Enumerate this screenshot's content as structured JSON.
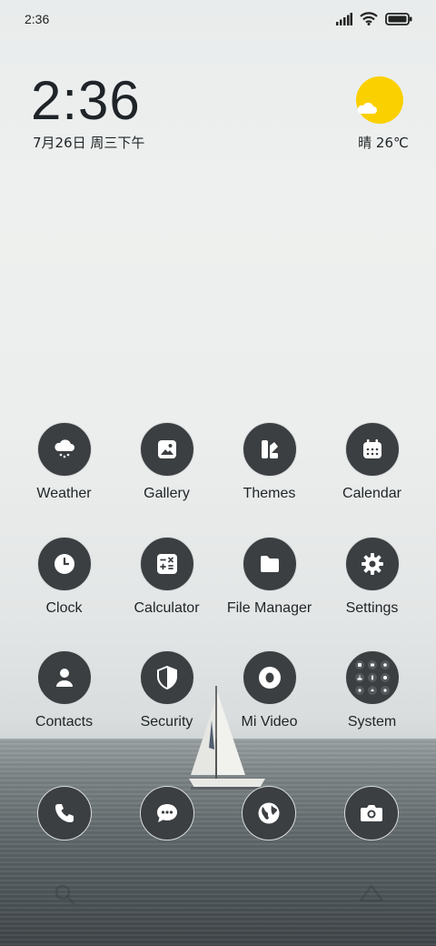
{
  "status": {
    "time": "2:36"
  },
  "clock": {
    "time": "2:36",
    "date": "7月26日 周三下午"
  },
  "weather": {
    "summary": "晴 26℃",
    "sun_color": "#fbd000"
  },
  "apps": [
    {
      "label": "Weather",
      "icon": "cloud-snow-icon"
    },
    {
      "label": "Gallery",
      "icon": "image-icon"
    },
    {
      "label": "Themes",
      "icon": "themes-icon"
    },
    {
      "label": "Calendar",
      "icon": "calendar-icon"
    },
    {
      "label": "Clock",
      "icon": "clock-icon"
    },
    {
      "label": "Calculator",
      "icon": "calculator-icon"
    },
    {
      "label": "File Manager",
      "icon": "folder-icon"
    },
    {
      "label": "Settings",
      "icon": "gear-icon"
    },
    {
      "label": "Contacts",
      "icon": "person-icon"
    },
    {
      "label": "Security",
      "icon": "shield-icon"
    },
    {
      "label": "Mi Video",
      "icon": "video-icon"
    },
    {
      "label": "System",
      "icon": "folder-grid-icon"
    }
  ],
  "dock": [
    {
      "icon": "phone-icon"
    },
    {
      "icon": "message-icon"
    },
    {
      "icon": "browser-globe-icon"
    },
    {
      "icon": "camera-icon"
    }
  ],
  "colors": {
    "icon_bg": "#3b3f42",
    "text": "#1f2427"
  }
}
